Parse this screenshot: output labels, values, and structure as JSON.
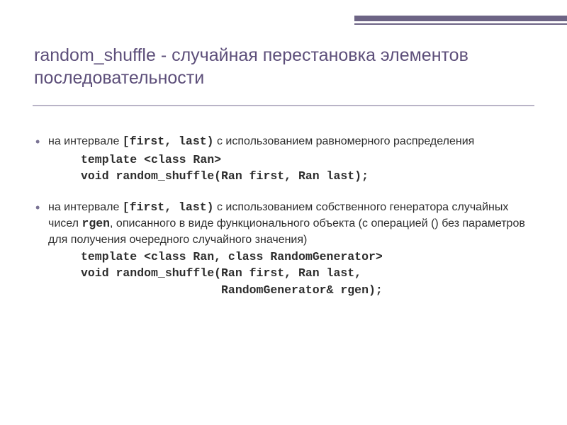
{
  "title": "random_shuffle - случайная перестановка элементов последовательности",
  "b1": {
    "pre": "на интервале ",
    "code1": "[first, last)",
    "post": " с использованием равномерного распределения",
    "line1": "template <class Ran>",
    "line2": "void random_shuffle(Ran first, Ran last);"
  },
  "b2": {
    "pre": "на интервале ",
    "code1": "[first, last)",
    "mid": " с использованием собственного генератора случайных чисел ",
    "code2": "rgen",
    "post": ", описанного в виде функционального объекта (с операцией () без параметров для получения очередного случайного значения)",
    "line1": "template <class Ran, class RandomGenerator>",
    "line2": "void random_shuffle(Ran first, Ran last,",
    "line3": "                    RandomGenerator& rgen);"
  }
}
